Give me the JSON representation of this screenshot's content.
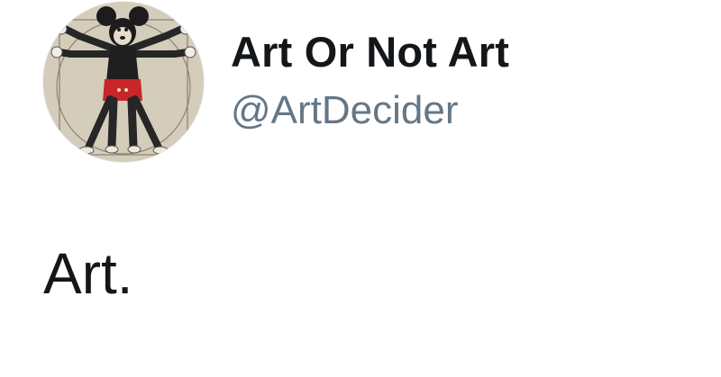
{
  "profile": {
    "display_name": "Art Or Not Art",
    "handle": "@ArtDecider",
    "avatar_icon": "vitruvian-mickey-avatar"
  },
  "tweet": {
    "text": "Art."
  },
  "colors": {
    "name": "#14171a",
    "handle": "#657786",
    "background": "#ffffff"
  }
}
